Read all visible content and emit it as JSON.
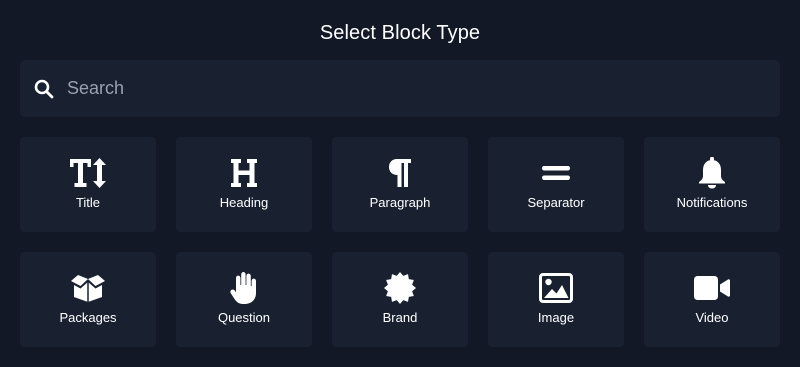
{
  "dialog": {
    "title": "Select Block Type"
  },
  "search": {
    "placeholder": "Search",
    "value": ""
  },
  "blocks": [
    {
      "label": "Title",
      "icon": "text-height-icon"
    },
    {
      "label": "Heading",
      "icon": "heading-icon"
    },
    {
      "label": "Paragraph",
      "icon": "paragraph-icon"
    },
    {
      "label": "Separator",
      "icon": "equals-icon"
    },
    {
      "label": "Notifications",
      "icon": "bell-icon"
    },
    {
      "label": "Packages",
      "icon": "box-open-icon"
    },
    {
      "label": "Question",
      "icon": "hand-icon"
    },
    {
      "label": "Brand",
      "icon": "certificate-icon"
    },
    {
      "label": "Image",
      "icon": "image-icon"
    },
    {
      "label": "Video",
      "icon": "video-icon"
    }
  ]
}
